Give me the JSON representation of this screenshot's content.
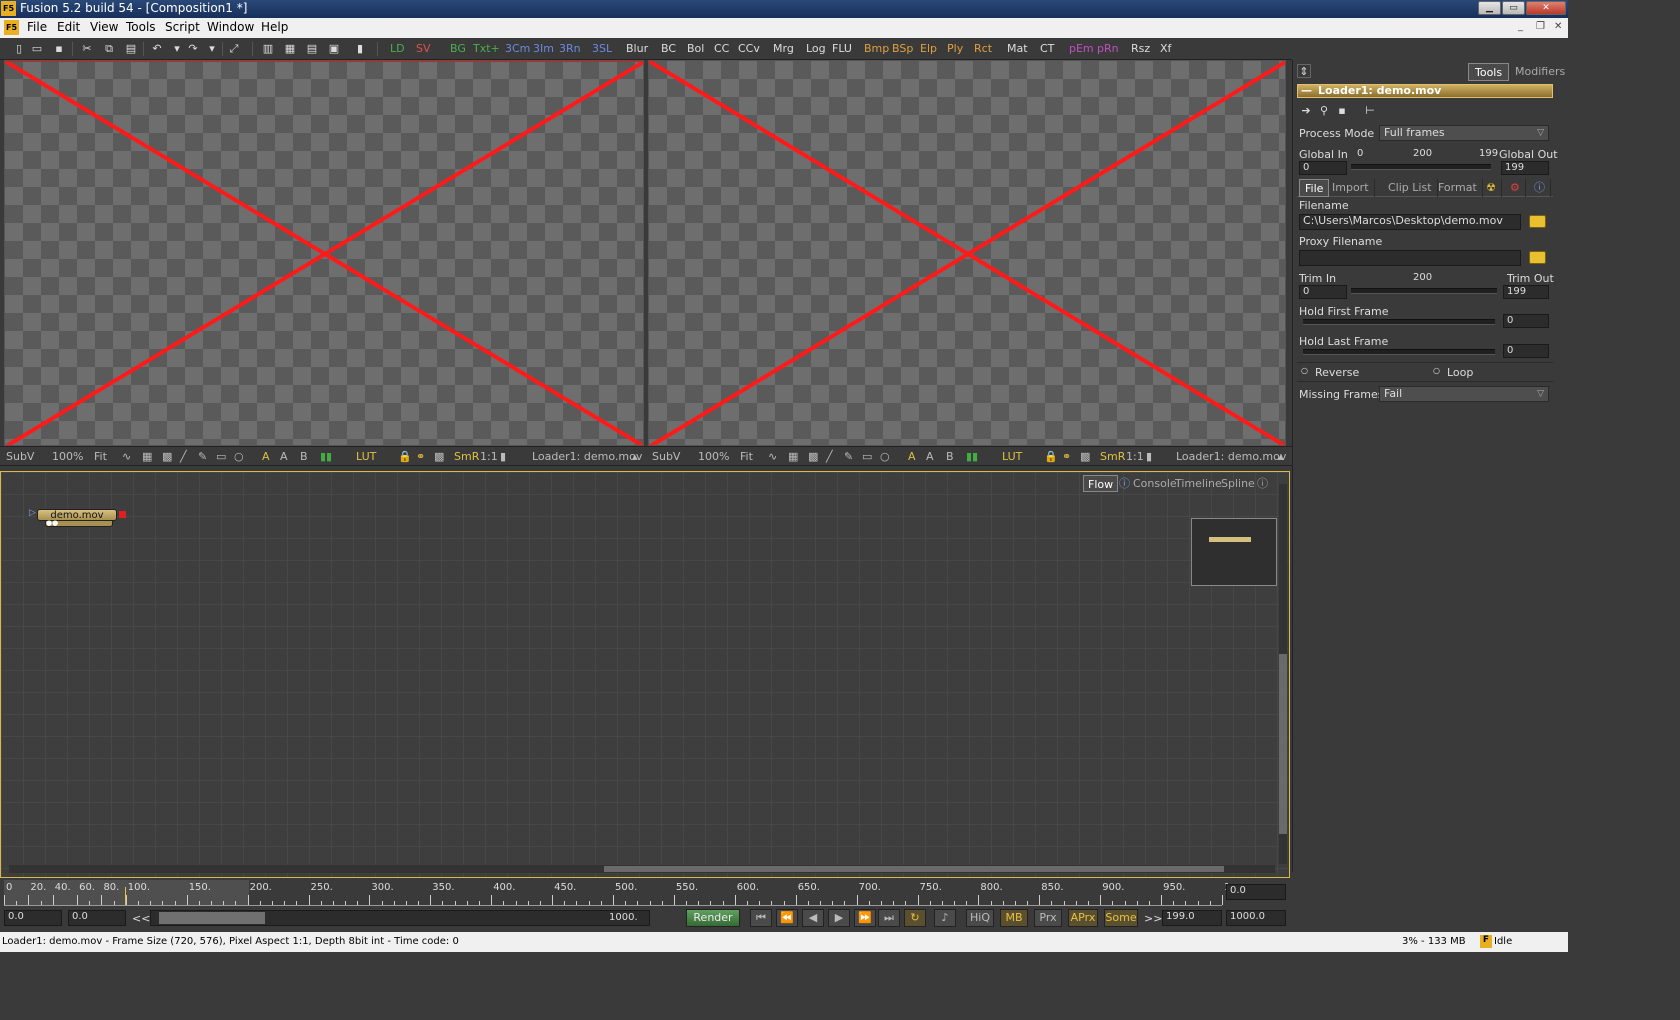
{
  "window": {
    "title": "Fusion 5.2 build 54 - [Composition1 *]",
    "icon_text": "F5"
  },
  "menu": [
    "File",
    "Edit",
    "View",
    "Tools",
    "Script",
    "Window",
    "Help"
  ],
  "toolbar": {
    "tools": [
      {
        "label": "LD",
        "color": "#4cae4c"
      },
      {
        "label": "SV",
        "color": "#e05050"
      },
      {
        "label": "BG",
        "color": "#4cae4c"
      },
      {
        "label": "Txt+",
        "color": "#4cae4c"
      },
      {
        "label": "3Cm",
        "color": "#6a8ae0"
      },
      {
        "label": "3Im",
        "color": "#6a8ae0"
      },
      {
        "label": "3Rn",
        "color": "#6a8ae0"
      },
      {
        "label": "3SL",
        "color": "#6a8ae0"
      },
      {
        "label": "Blur",
        "color": "#dddddd"
      },
      {
        "label": "BC",
        "color": "#dddddd"
      },
      {
        "label": "Bol",
        "color": "#dddddd"
      },
      {
        "label": "CC",
        "color": "#dddddd"
      },
      {
        "label": "CCv",
        "color": "#dddddd"
      },
      {
        "label": "Mrg",
        "color": "#dddddd"
      },
      {
        "label": "Log",
        "color": "#dddddd"
      },
      {
        "label": "FLU",
        "color": "#dddddd"
      },
      {
        "label": "Bmp",
        "color": "#e0a040"
      },
      {
        "label": "BSp",
        "color": "#e0a040"
      },
      {
        "label": "Elp",
        "color": "#e0a040"
      },
      {
        "label": "Ply",
        "color": "#e0a040"
      },
      {
        "label": "Rct",
        "color": "#e0a040"
      },
      {
        "label": "Mat",
        "color": "#dddddd"
      },
      {
        "label": "CT",
        "color": "#dddddd"
      },
      {
        "label": "pEm",
        "color": "#c050c0"
      },
      {
        "label": "pRn",
        "color": "#c050c0"
      },
      {
        "label": "Rsz",
        "color": "#dddddd"
      },
      {
        "label": "Xf",
        "color": "#dddddd"
      }
    ]
  },
  "viewers": [
    {
      "subv": "SubV",
      "zoom": "100%",
      "fit": "Fit",
      "lut": "LUT",
      "smr": "SmR",
      "ratio": "1:1",
      "caption": "Loader1: demo.mov",
      "channels": [
        "A",
        "A",
        "B"
      ]
    },
    {
      "subv": "SubV",
      "zoom": "100%",
      "fit": "Fit",
      "lut": "LUT",
      "smr": "SmR",
      "ratio": "1:1",
      "caption": "Loader1: demo.mov",
      "channels": [
        "A",
        "A",
        "B"
      ]
    }
  ],
  "panel": {
    "tabs": [
      "Tools",
      "Modifiers"
    ],
    "header": "Loader1: demo.mov",
    "process_mode": {
      "label": "Process Mode",
      "value": "Full frames"
    },
    "global": {
      "in_label": "Global In",
      "out_label": "Global Out",
      "start": "0",
      "mid": "200",
      "end": "199",
      "in_value": "0",
      "out_value": "199"
    },
    "subtabs": [
      "File",
      "Import",
      "Clip List",
      "Format"
    ],
    "filename": {
      "label": "Filename",
      "value": "C:\\Users\\Marcos\\Desktop\\demo.mov"
    },
    "proxy": {
      "label": "Proxy Filename",
      "value": ""
    },
    "trim": {
      "in_label": "Trim In",
      "out_label": "Trim Out",
      "mid": "200",
      "in_value": "0",
      "out_value": "199"
    },
    "hold_first": {
      "label": "Hold First Frame",
      "value": "0"
    },
    "hold_last": {
      "label": "Hold Last Frame",
      "value": "0"
    },
    "reverse": "Reverse",
    "loop": "Loop",
    "missing": {
      "label": "Missing Frames",
      "value": "Fail"
    }
  },
  "flow": {
    "tabs": [
      "Flow",
      "Console",
      "Timeline",
      "Spline"
    ],
    "node": "demo.mov"
  },
  "timeline": {
    "labels": [
      "0",
      "20.",
      "40.",
      "60.",
      "80.",
      "100.",
      "150.",
      "200.",
      "250.",
      "300.",
      "350.",
      "400.",
      "450.",
      "500.",
      "550.",
      "600.",
      "650.",
      "700.",
      "750.",
      "800.",
      "850.",
      "900.",
      "950.",
      "1"
    ],
    "frame_display": "0.0"
  },
  "controls": {
    "start": "0.0",
    "current": "0.0",
    "end_range": "1000.",
    "render": "Render",
    "buttons": [
      "HiQ",
      "MB",
      "Prx",
      "APrx",
      "Some"
    ],
    "render_end": "199.0",
    "global_end": "1000.0",
    "rewind": "<<",
    "forward": ">>"
  },
  "status": {
    "text": "Loader1: demo.mov - Frame Size (720, 576), Pixel Aspect 1:1, Depth 8bit int - Time code: 0",
    "memory": "3% - 133 MB",
    "state": "Idle"
  }
}
